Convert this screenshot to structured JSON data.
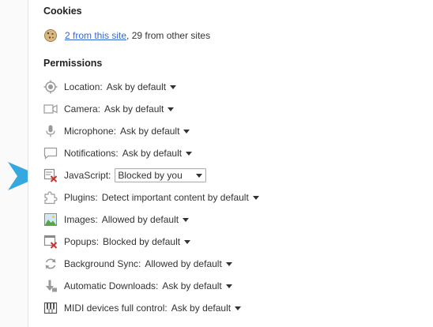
{
  "cookies": {
    "title": "Cookies",
    "link_text": "2 from this site",
    "rest_text": ", 29 from other sites",
    "icon": "cookie-icon"
  },
  "permissions": {
    "title": "Permissions",
    "items": [
      {
        "label": "Location:",
        "value": "Ask by default",
        "icon": "location-icon"
      },
      {
        "label": "Camera:",
        "value": "Ask by default",
        "icon": "camera-icon"
      },
      {
        "label": "Microphone:",
        "value": "Ask by default",
        "icon": "microphone-icon"
      },
      {
        "label": "Notifications:",
        "value": "Ask by default",
        "icon": "notifications-icon"
      },
      {
        "label": "JavaScript:",
        "value": "Blocked by you",
        "icon": "javascript-blocked-icon",
        "highlighted": true
      },
      {
        "label": "Plugins:",
        "value": "Detect important content by default",
        "icon": "plugins-icon"
      },
      {
        "label": "Images:",
        "value": "Allowed by default",
        "icon": "images-icon"
      },
      {
        "label": "Popups:",
        "value": "Blocked by default",
        "icon": "popups-blocked-icon"
      },
      {
        "label": "Background Sync:",
        "value": "Allowed by default",
        "icon": "background-sync-icon"
      },
      {
        "label": "Automatic Downloads:",
        "value": "Ask by default",
        "icon": "download-icon"
      },
      {
        "label": "MIDI devices full control:",
        "value": "Ask by default",
        "icon": "midi-icon"
      }
    ]
  },
  "colors": {
    "link": "#3367d6",
    "pointer_arrow": "#35a8e0",
    "blocked_x": "#d32f2f",
    "icon_gray": "#9a9a9a"
  }
}
